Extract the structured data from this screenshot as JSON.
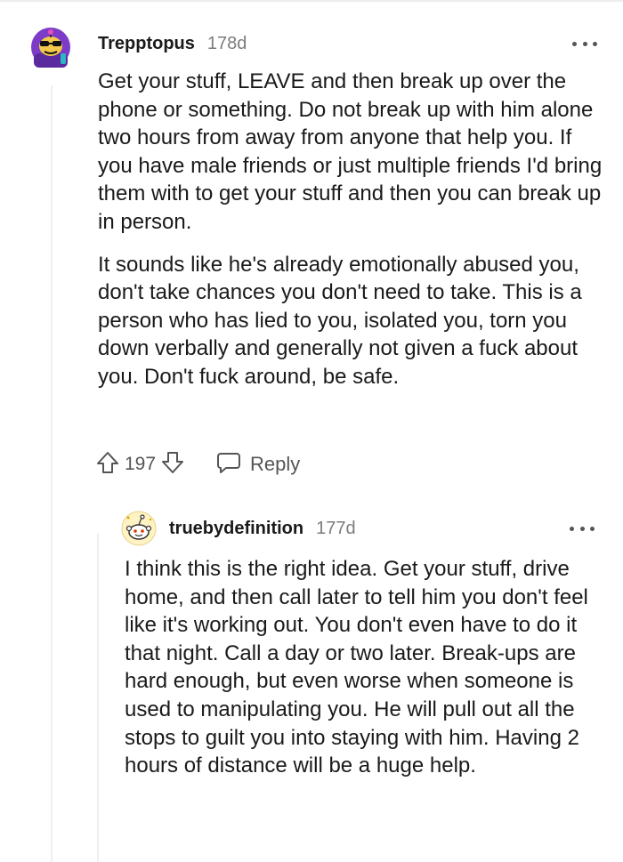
{
  "comments": [
    {
      "username": "Trepptopus",
      "age": "178d",
      "avatar_icon": "snoo-avatar-purple-sunglasses-icon",
      "paragraphs": [
        "Get your stuff, LEAVE and then break up over the phone or something. Do not break up with him alone two hours from away from anyone that help you. If you have male friends or just multiple friends I'd bring them with to get your stuff and then you can break up in person.",
        "It sounds like he's already emotionally abused you, don't take chances you don't need to take. This is a person who has lied to you, isolated you, torn you down verbally and generally not given a fuck about you. Don't fuck around, be safe."
      ],
      "votes": "197",
      "reply_label": "Reply"
    },
    {
      "username": "truebydefinition",
      "age": "177d",
      "avatar_icon": "snoo-avatar-default-icon",
      "paragraphs": [
        "I think this is the right idea. Get your stuff, drive home, and then call later to tell him you don't feel like it's working out. You don't even have to do it that night. Call a day or two later. Break-ups are hard enough, but even worse when someone is used to manipulating you. He will pull out all the stops to guilt you into staying with him. Having 2 hours of distance will be a huge help."
      ]
    }
  ],
  "colors": {
    "text": "#1a1a1b",
    "meta": "#7c7c7c",
    "action": "#555555",
    "thread_line": "#edeff1"
  }
}
